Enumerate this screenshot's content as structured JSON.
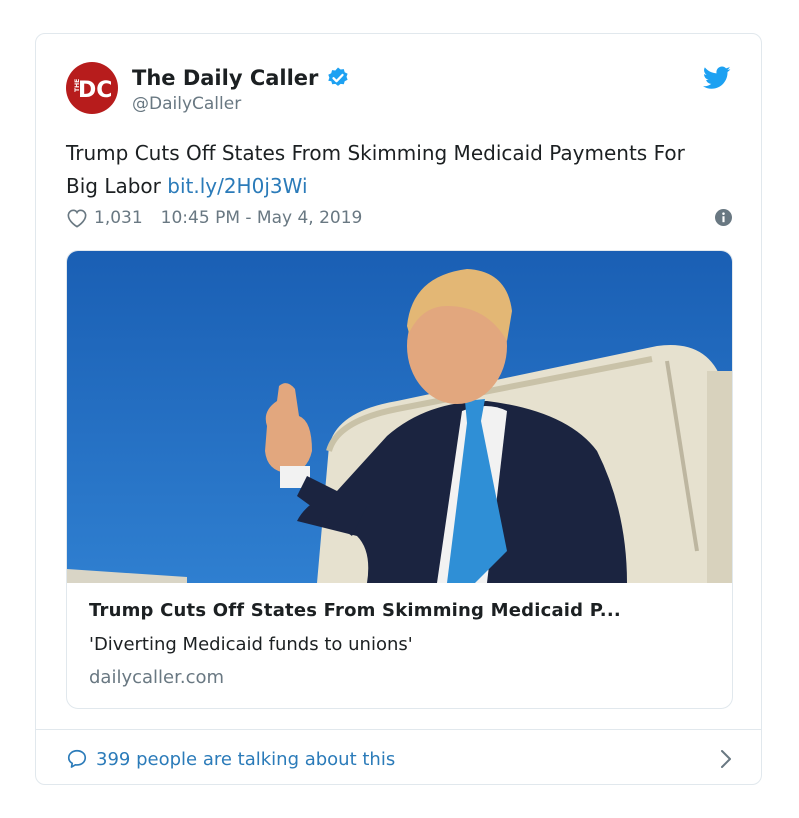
{
  "account": {
    "name": "The Daily Caller",
    "handle": "@DailyCaller",
    "avatar_text": "DC",
    "avatar_small_text": "THE",
    "brand_color": "#b71c1c",
    "verified_color": "#1da1f2"
  },
  "tweet": {
    "text": "Trump Cuts Off States From Skimming Medicaid Payments For Big Labor ",
    "link": "bit.ly/2H0j3Wi",
    "likes": "1,031",
    "timestamp": "10:45 PM - May 4, 2019"
  },
  "card": {
    "title": "Trump Cuts Off States From Skimming Medicaid P...",
    "description": "'Diverting Medicaid funds to unions'",
    "domain": "dailycaller.com"
  },
  "footer": {
    "conversation_text": "399 people are talking about this"
  },
  "colors": {
    "link": "#2b7bb9",
    "muted": "#697882",
    "border": "#e1e8ed",
    "sky": "#1f6fc4"
  },
  "icons": [
    "verified-icon",
    "twitter-bird-icon",
    "heart-icon",
    "info-icon",
    "speech-bubble-icon",
    "chevron-right-icon"
  ]
}
